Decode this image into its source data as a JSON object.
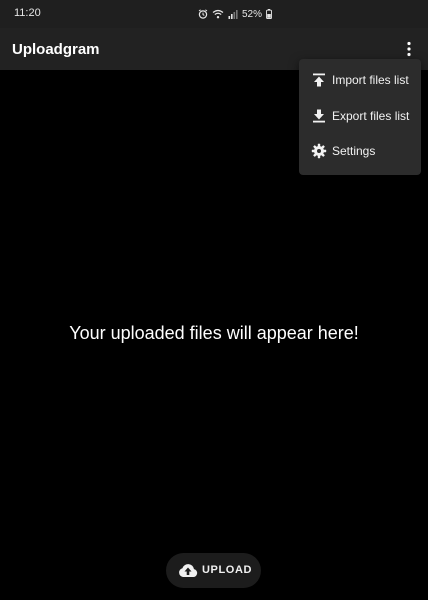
{
  "status_bar": {
    "time": "11:20",
    "battery": "52%",
    "icons": [
      "alarm-icon",
      "wifi-icon",
      "signal-icon",
      "battery-icon"
    ]
  },
  "app_bar": {
    "title": "Uploadgram",
    "overflow_icon": "more-vert-icon"
  },
  "menu": {
    "items": [
      {
        "label": "Import files list",
        "icon": "upload-icon"
      },
      {
        "label": "Export files list",
        "icon": "download-icon"
      },
      {
        "label": "Settings",
        "icon": "gear-icon"
      }
    ]
  },
  "main": {
    "empty_message": "Your uploaded files will appear here!"
  },
  "upload_button": {
    "label": "UPLOAD",
    "icon": "cloud-upload-icon"
  },
  "colors": {
    "background": "#000000",
    "app_bar": "#222222",
    "menu": "#2c2c2c",
    "text": "#ffffff"
  }
}
